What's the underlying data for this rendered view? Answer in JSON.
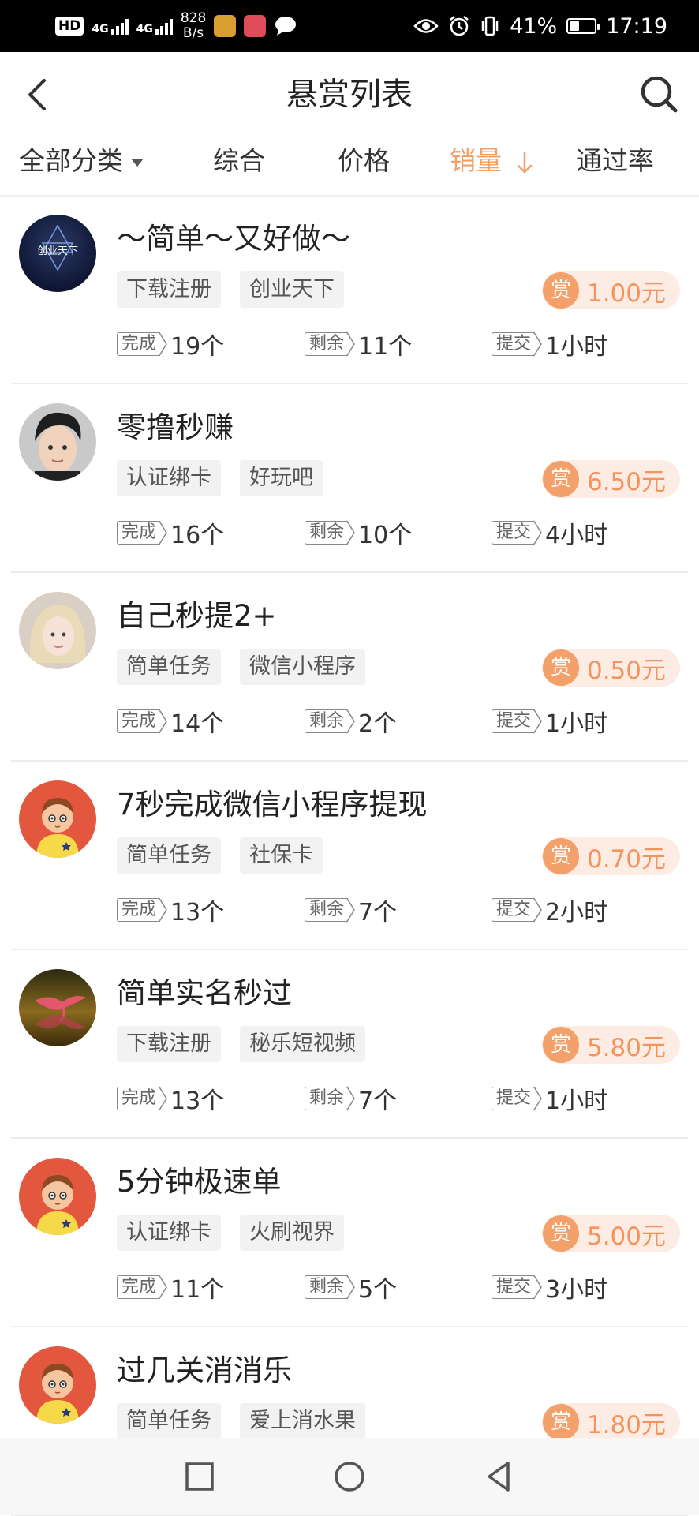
{
  "status_bar": {
    "hd": "HD",
    "net1": "4G",
    "net2": "4G",
    "speed_value": "828",
    "speed_unit": "B/s",
    "battery": "41%",
    "battery_level": 0.41,
    "time": "17:19"
  },
  "header": {
    "title": "悬赏列表"
  },
  "sort_bar": {
    "category": "全部分类",
    "composite": "综合",
    "price": "价格",
    "sales": "销量",
    "pass_rate": "通过率",
    "active_color": "#f0a068"
  },
  "labels": {
    "reward_badge": "赏",
    "done": "完成",
    "remaining": "剩余",
    "submit": "提交"
  },
  "tasks": [
    {
      "title": "～简单～又好做～",
      "tags": [
        "下载注册",
        "创业天下"
      ],
      "reward": "1.00元",
      "done": "19个",
      "remaining": "11个",
      "submit": "1小时",
      "avatar": "brand",
      "avatar_text": "创业天下"
    },
    {
      "title": "零撸秒赚",
      "tags": [
        "认证绑卡",
        "好玩吧"
      ],
      "reward": "6.50元",
      "done": "16个",
      "remaining": "10个",
      "submit": "4小时",
      "avatar": "boy"
    },
    {
      "title": "自己秒提2+",
      "tags": [
        "简单任务",
        "微信小程序"
      ],
      "reward": "0.50元",
      "done": "14个",
      "remaining": "2个",
      "submit": "1小时",
      "avatar": "girl"
    },
    {
      "title": "7秒完成微信小程序提现",
      "tags": [
        "简单任务",
        "社保卡"
      ],
      "reward": "0.70元",
      "done": "13个",
      "remaining": "7个",
      "submit": "2小时",
      "avatar": "cartoon"
    },
    {
      "title": "简单实名秒过",
      "tags": [
        "下载注册",
        "秘乐短视频"
      ],
      "reward": "5.80元",
      "done": "13个",
      "remaining": "7个",
      "submit": "1小时",
      "avatar": "flamingo"
    },
    {
      "title": "5分钟极速单",
      "tags": [
        "认证绑卡",
        "火刷视界"
      ],
      "reward": "5.00元",
      "done": "11个",
      "remaining": "5个",
      "submit": "3小时",
      "avatar": "cartoon"
    },
    {
      "title": "过几关消消乐",
      "tags": [
        "简单任务",
        "爱上消水果"
      ],
      "reward": "1.80元",
      "done": "",
      "remaining": "",
      "submit": "",
      "avatar": "cartoon"
    }
  ],
  "colors": {
    "accent": "#f4a06a",
    "reward_text": "#f4945c",
    "reward_bg": "#fdece3",
    "tag_bg": "#f2f2f2"
  }
}
